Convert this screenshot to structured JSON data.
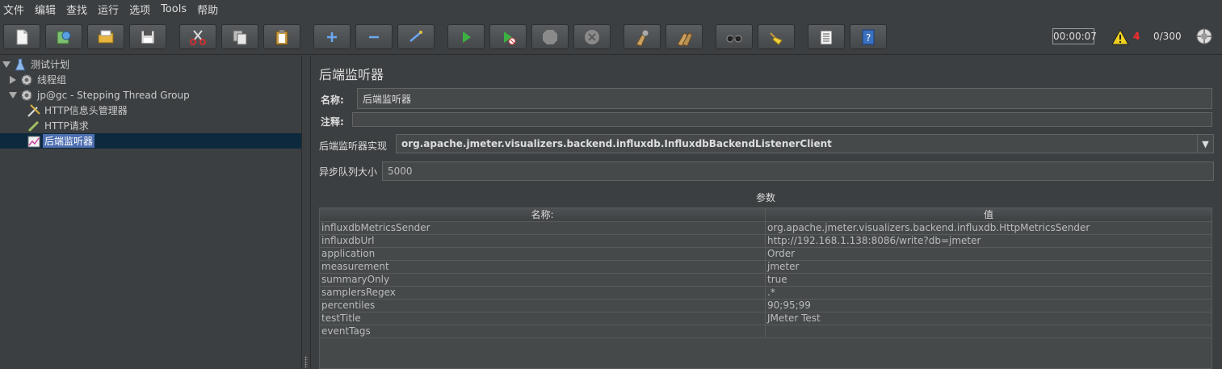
{
  "menu": [
    "文件",
    "编辑",
    "查找",
    "运行",
    "选项",
    "Tools",
    "帮助"
  ],
  "toolbar": {
    "buttons": [
      "new-icon",
      "templates-icon",
      "open-icon",
      "save-icon",
      "cut-icon",
      "copy-icon",
      "paste-icon",
      "expand-icon",
      "collapse-icon",
      "toggle-icon",
      "start-icon",
      "start-no-pause-icon",
      "stop-icon",
      "shutdown-icon",
      "clear-icon",
      "clear-all-icon",
      "search-icon",
      "reset-search-icon",
      "function-helper-icon",
      "help-icon"
    ],
    "timer": "00:00:07",
    "warning_count": "4",
    "threads": "0/300"
  },
  "tree": {
    "items": [
      {
        "label": "测试计划",
        "icon": "test-plan-icon"
      },
      {
        "label": "线程组",
        "icon": "gear-icon"
      },
      {
        "label": "jp@gc - Stepping Thread Group",
        "icon": "gear-icon"
      },
      {
        "label": "HTTP信息头管理器",
        "icon": "wrench-icon"
      },
      {
        "label": "HTTP请求",
        "icon": "pen-icon"
      },
      {
        "label": "后端监听器",
        "icon": "chart-icon"
      }
    ]
  },
  "panel": {
    "title": "后端监听器",
    "name_label": "名称:",
    "name_value": "后端监听器",
    "comment_label": "注释:",
    "comment_value": "",
    "impl_label": "后端监听器实现",
    "impl_value": "org.apache.jmeter.visualizers.backend.influxdb.InfluxdbBackendListenerClient",
    "queue_label": "异步队列大小",
    "queue_value": "5000",
    "params_label": "参数",
    "table": {
      "headers": [
        "名称:",
        "值"
      ],
      "rows": [
        [
          "influxdbMetricsSender",
          "org.apache.jmeter.visualizers.backend.influxdb.HttpMetricsSender"
        ],
        [
          "influxdbUrl",
          "http://192.168.1.138:8086/write?db=jmeter"
        ],
        [
          "application",
          "Order"
        ],
        [
          "measurement",
          "jmeter"
        ],
        [
          "summaryOnly",
          "true"
        ],
        [
          "samplersRegex",
          ".*"
        ],
        [
          "percentiles",
          "90;95;99"
        ],
        [
          "testTitle",
          "JMeter Test"
        ],
        [
          "eventTags",
          ""
        ]
      ]
    }
  }
}
